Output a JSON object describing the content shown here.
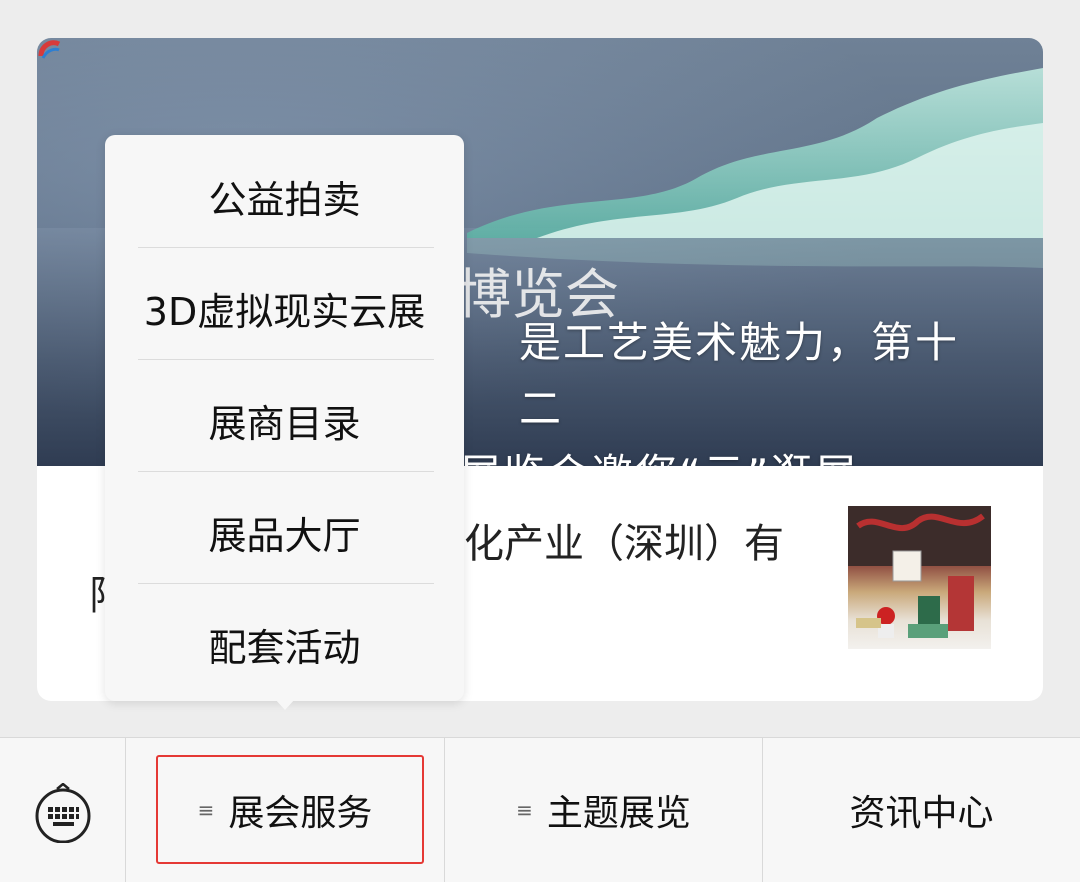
{
  "article": {
    "title_line1": "是工艺美术魅力，第十二",
    "title_line2": "展览会邀您“云”逛展",
    "banner_calligraphy": "博览会",
    "source_line1": "化产业（深圳）有",
    "source_line2": "限"
  },
  "popup_menu": {
    "items": [
      {
        "label": "公益拍卖"
      },
      {
        "label": "3D虚拟现实云展"
      },
      {
        "label": "展商目录"
      },
      {
        "label": "展品大厅"
      },
      {
        "label": "配套活动"
      }
    ]
  },
  "bottom_bar": {
    "keyboard_icon": "keyboard-icon",
    "tabs": [
      {
        "label": "展会服务",
        "icon": "menu-lines-icon",
        "highlighted": true
      },
      {
        "label": "主题展览",
        "icon": "menu-lines-icon"
      },
      {
        "label": "资讯中心"
      }
    ],
    "highlight_color": "#e53935"
  }
}
